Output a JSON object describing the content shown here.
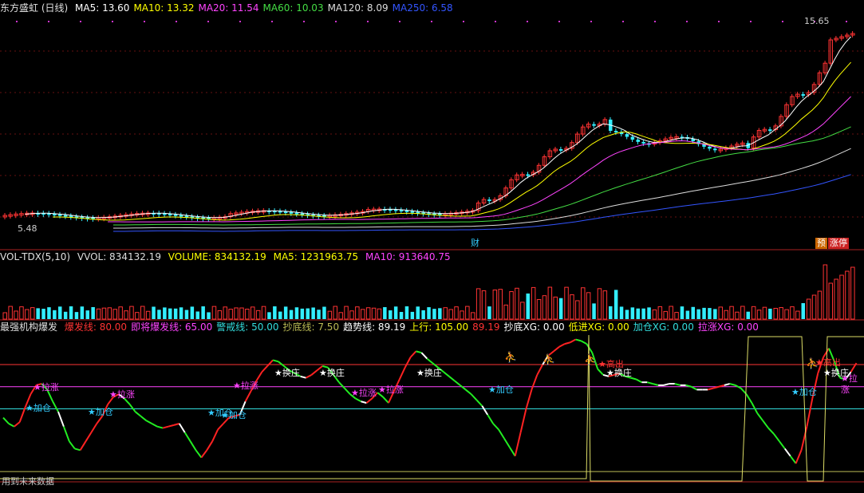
{
  "price_panel": {
    "title": "东方盛虹 (日线)",
    "ma": [
      {
        "label": "MA5: 13.60",
        "color": "#ffffff"
      },
      {
        "label": "MA10: 13.32",
        "color": "#ffff00"
      },
      {
        "label": "MA20: 11.54",
        "color": "#ff44ff"
      },
      {
        "label": "MA60: 10.03",
        "color": "#44dd44"
      },
      {
        "label": "MA120: 8.09",
        "color": "#dddddd"
      },
      {
        "label": "MA250: 6.58",
        "color": "#3355ff"
      }
    ],
    "high_label": "15.65",
    "low_label": "5.48",
    "cai_label": "财",
    "yu_label": "预",
    "zhang_label": "涨停"
  },
  "volume_panel": {
    "title": "VOL-TDX(5,10)",
    "vvol": "VVOL: 834132.19",
    "volume": "VOLUME: 834132.19",
    "ma5": "MA5: 1231963.75",
    "ma10": "MA10: 913640.75"
  },
  "indicator_panel": {
    "title": "最强机构爆发",
    "items": [
      {
        "label": "爆发线: 80.00",
        "color": "#ff3333"
      },
      {
        "label": "即将爆发线: 65.00",
        "color": "#ff44ff"
      },
      {
        "label": "警戒线: 50.00",
        "color": "#33dddd"
      },
      {
        "label": "抄底线: 7.50",
        "color": "#bbbb55"
      },
      {
        "label": "趋势线: 89.19",
        "color": "#ffffff"
      },
      {
        "label": "上行: 105.00",
        "color": "#ffff00"
      },
      {
        "label": "89.19",
        "color": "#ff3333"
      },
      {
        "label": "抄底XG: 0.00",
        "color": "#ffffff"
      },
      {
        "label": "低进XG: 0.00",
        "color": "#ffff00"
      },
      {
        "label": "加仓XG: 0.00",
        "color": "#33dddd"
      },
      {
        "label": "拉涨XG: 0.00",
        "color": "#ff44ff"
      }
    ],
    "signal_labels": {
      "jiacang": "加仓",
      "lazhang": "拉涨",
      "huanzhuang": "换庄",
      "maochu": "高出"
    },
    "signals": [
      {
        "type": "jiacang",
        "x": 30,
        "y": 512
      },
      {
        "type": "lazhang",
        "x": 40,
        "y": 486
      },
      {
        "type": "jiacang",
        "x": 108,
        "y": 517
      },
      {
        "type": "lazhang",
        "x": 135,
        "y": 495
      },
      {
        "type": "jiacang",
        "x": 258,
        "y": 518
      },
      {
        "type": "jiacang",
        "x": 275,
        "y": 521
      },
      {
        "type": "lazhang",
        "x": 290,
        "y": 484
      },
      {
        "type": "huanzhuang",
        "x": 342,
        "y": 468
      },
      {
        "type": "huanzhuang",
        "x": 398,
        "y": 468
      },
      {
        "type": "lazhang",
        "x": 438,
        "y": 493
      },
      {
        "type": "lazhang",
        "x": 472,
        "y": 489
      },
      {
        "type": "huanzhuang",
        "x": 520,
        "y": 468
      },
      {
        "type": "jiacang",
        "x": 610,
        "y": 489
      },
      {
        "type": "maochu",
        "x": 748,
        "y": 457
      },
      {
        "type": "huanzhuang",
        "x": 758,
        "y": 468
      },
      {
        "type": "jiacang",
        "x": 990,
        "y": 492
      },
      {
        "type": "maochu",
        "x": 1020,
        "y": 455
      },
      {
        "type": "huanzhuang",
        "x": 1030,
        "y": 468
      },
      {
        "type": "lazhang",
        "x": 1052,
        "y": 475
      }
    ],
    "bottom_text": "用到未来数据"
  },
  "chart_data": {
    "type": "line",
    "series": [
      {
        "name": "趋势线",
        "values": [
          44,
          40,
          38,
          41,
          51,
          60,
          66,
          67,
          63,
          55,
          48,
          38,
          28,
          23,
          22,
          28,
          34,
          40,
          45,
          53,
          58,
          60,
          57,
          53,
          48,
          45,
          42,
          40,
          38,
          37,
          38,
          39,
          40,
          34,
          28,
          22,
          17,
          22,
          28,
          36,
          40,
          44,
          45,
          46,
          55,
          62,
          69,
          75,
          79,
          83,
          82,
          79,
          76,
          74,
          72,
          71,
          73,
          76,
          79,
          78,
          73,
          68,
          64,
          60,
          57,
          55,
          54,
          57,
          61,
          58,
          54,
          62,
          70,
          78,
          85,
          89,
          88,
          84,
          81,
          78,
          75,
          72,
          69,
          66,
          63,
          60,
          56,
          52,
          46,
          40,
          36,
          30,
          24,
          18,
          34,
          50,
          63,
          73,
          80,
          86,
          89,
          92,
          94,
          95,
          97,
          96,
          94,
          88,
          77,
          73,
          72,
          73,
          74,
          72,
          71,
          70,
          68,
          68,
          67,
          66,
          66,
          67,
          67,
          66,
          66,
          65,
          63,
          63,
          63,
          64,
          65,
          66,
          67,
          66,
          64,
          60,
          54,
          47,
          42,
          37,
          33,
          28,
          23,
          18,
          13,
          22,
          38,
          57,
          74,
          85,
          91,
          82,
          71,
          70,
          75,
          81
        ]
      }
    ]
  }
}
